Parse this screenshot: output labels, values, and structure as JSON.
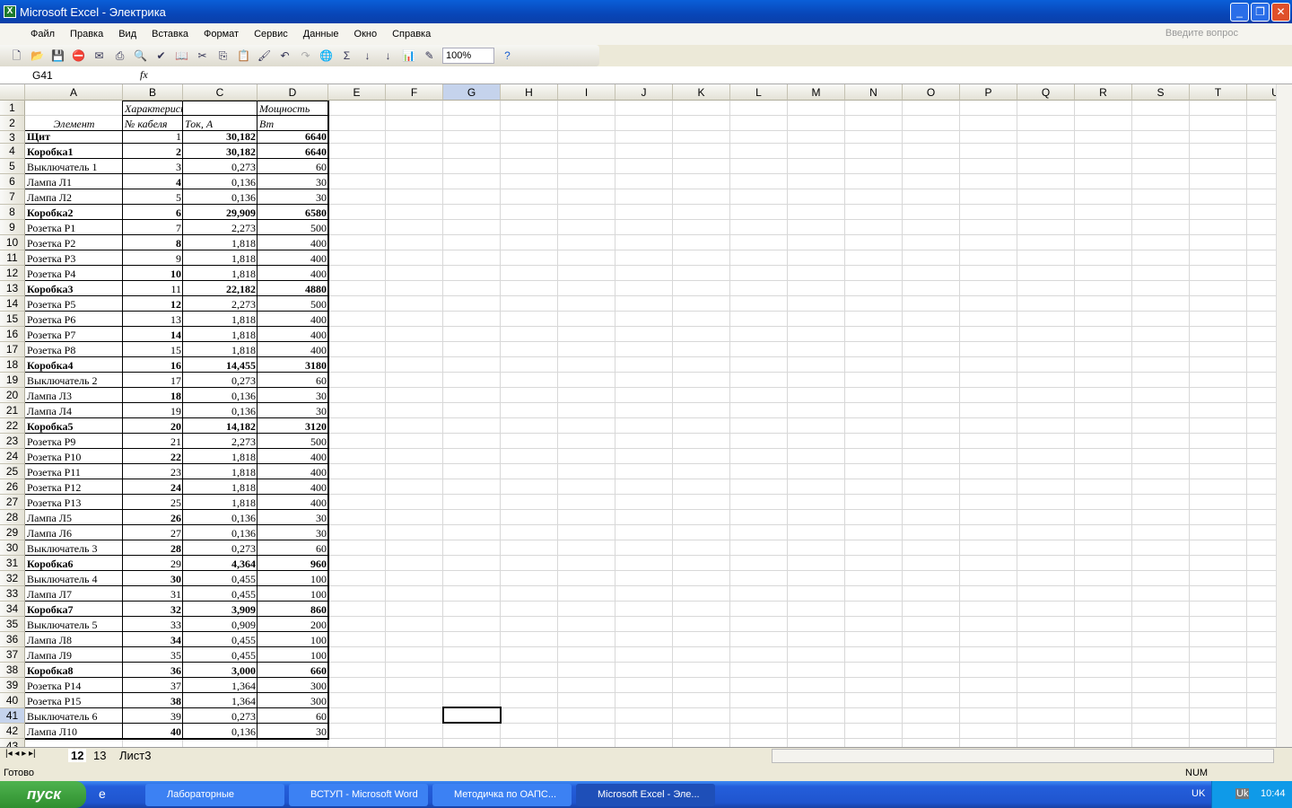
{
  "window": {
    "title": "Microsoft Excel - Электрика",
    "icon": "excel-icon"
  },
  "menu": [
    "Файл",
    "Правка",
    "Вид",
    "Вставка",
    "Формат",
    "Сервис",
    "Данные",
    "Окно",
    "Справка"
  ],
  "ask_placeholder": "Введите вопрос",
  "toolbar": {
    "zoom": "100%",
    "sigma": "Σ"
  },
  "namebox": "G41",
  "fx": "fx",
  "columns": [
    "A",
    "B",
    "C",
    "D",
    "E",
    "F",
    "G",
    "H",
    "I",
    "J",
    "K",
    "L",
    "M",
    "N",
    "O",
    "P",
    "Q",
    "R",
    "S",
    "T",
    "U"
  ],
  "header": {
    "a2": "Элемент",
    "b1": "Характеристика кабеля",
    "d1": "Мощность",
    "b2": "№ кабеля",
    "c2": "Ток, А",
    "d2": "Вт"
  },
  "rows": [
    [
      "Щит",
      "1",
      "30,182",
      "6640",
      true
    ],
    [
      "Коробка1",
      "2",
      "30,182",
      "6640",
      true
    ],
    [
      "Выключатель 1",
      "3",
      "0,273",
      "60",
      false
    ],
    [
      "Лампа Л1",
      "4",
      "0,136",
      "30",
      false
    ],
    [
      "Лампа Л2",
      "5",
      "0,136",
      "30",
      false
    ],
    [
      "Коробка2",
      "6",
      "29,909",
      "6580",
      true
    ],
    [
      "Розетка Р1",
      "7",
      "2,273",
      "500",
      false
    ],
    [
      "Розетка Р2",
      "8",
      "1,818",
      "400",
      false
    ],
    [
      "Розетка Р3",
      "9",
      "1,818",
      "400",
      false
    ],
    [
      "Розетка Р4",
      "10",
      "1,818",
      "400",
      false
    ],
    [
      "Коробка3",
      "11",
      "22,182",
      "4880",
      true
    ],
    [
      "Розетка Р5",
      "12",
      "2,273",
      "500",
      false
    ],
    [
      "Розетка Р6",
      "13",
      "1,818",
      "400",
      false
    ],
    [
      "Розетка Р7",
      "14",
      "1,818",
      "400",
      false
    ],
    [
      "Розетка Р8",
      "15",
      "1,818",
      "400",
      false
    ],
    [
      "Коробка4",
      "16",
      "14,455",
      "3180",
      true
    ],
    [
      "Выключатель 2",
      "17",
      "0,273",
      "60",
      false
    ],
    [
      "Лампа Л3",
      "18",
      "0,136",
      "30",
      false
    ],
    [
      "Лампа Л4",
      "19",
      "0,136",
      "30",
      false
    ],
    [
      "Коробка5",
      "20",
      "14,182",
      "3120",
      true
    ],
    [
      "Розетка Р9",
      "21",
      "2,273",
      "500",
      false
    ],
    [
      "Розетка Р10",
      "22",
      "1,818",
      "400",
      false
    ],
    [
      "Розетка Р11",
      "23",
      "1,818",
      "400",
      false
    ],
    [
      "Розетка Р12",
      "24",
      "1,818",
      "400",
      false
    ],
    [
      "Розетка Р13",
      "25",
      "1,818",
      "400",
      false
    ],
    [
      "Лампа Л5",
      "26",
      "0,136",
      "30",
      false
    ],
    [
      "Лампа Л6",
      "27",
      "0,136",
      "30",
      false
    ],
    [
      "Выключатель 3",
      "28",
      "0,273",
      "60",
      false
    ],
    [
      "Коробка6",
      "29",
      "4,364",
      "960",
      true
    ],
    [
      "Выключатель 4",
      "30",
      "0,455",
      "100",
      false
    ],
    [
      "Лампа Л7",
      "31",
      "0,455",
      "100",
      false
    ],
    [
      "Коробка7",
      "32",
      "3,909",
      "860",
      true
    ],
    [
      "Выключатель 5",
      "33",
      "0,909",
      "200",
      false
    ],
    [
      "Лампа Л8",
      "34",
      "0,455",
      "100",
      false
    ],
    [
      "Лампа Л9",
      "35",
      "0,455",
      "100",
      false
    ],
    [
      "Коробка8",
      "36",
      "3,000",
      "660",
      true
    ],
    [
      "Розетка Р14",
      "37",
      "1,364",
      "300",
      false
    ],
    [
      "Розетка Р15",
      "38",
      "1,364",
      "300",
      false
    ],
    [
      "Выключатель 6",
      "39",
      "0,273",
      "60",
      false
    ],
    [
      "Лампа Л10",
      "40",
      "0,136",
      "30",
      false
    ]
  ],
  "sheet_tabs": [
    "12",
    "13",
    "Лист3"
  ],
  "status": {
    "left": "Готово",
    "num": "NUM"
  },
  "taskbar": {
    "start": "пуск",
    "tasks": [
      "Лабораторные",
      "ВСТУП - Microsoft Word",
      "Методичка по ОАПС...",
      "Microsoft Excel - Эле..."
    ],
    "lang": "UK",
    "lang2": "Uk",
    "time": "10:44"
  }
}
